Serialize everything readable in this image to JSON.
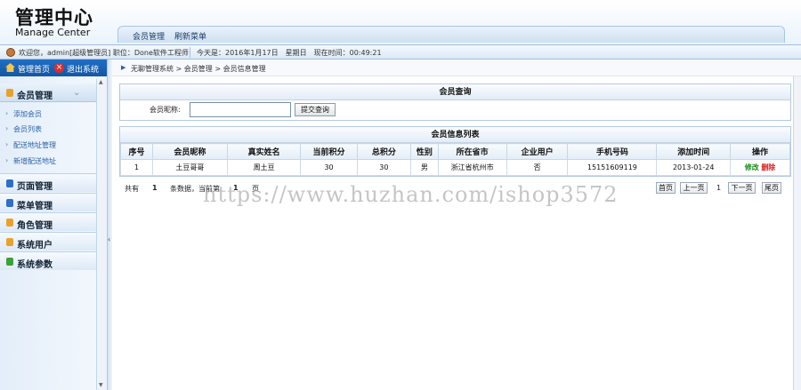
{
  "header": {
    "logo_cn": "管理中心",
    "logo_en": "Manage Center",
    "nav": [
      "会员管理",
      "刷新菜单"
    ]
  },
  "infobar": {
    "welcome": "欢迎您，admin[超级管理员] 职位：Done软件工程师",
    "today": "今天是：2016年1月17日　星期日　现在时间：00:49:21"
  },
  "sidebar": {
    "home": "管理首页",
    "exit": "退出系统",
    "groups": [
      {
        "label": "会员管理",
        "icon_color": "#e8a22b",
        "expanded": true,
        "items": [
          "添加会员",
          "会员列表",
          "配送地址管理",
          "新增配送地址"
        ]
      },
      {
        "label": "页面管理",
        "icon_color": "#2f6fc4"
      },
      {
        "label": "菜单管理",
        "icon_color": "#2f6fc4"
      },
      {
        "label": "角色管理",
        "icon_color": "#e8a22b"
      },
      {
        "label": "系统用户",
        "icon_color": "#e8a22b"
      },
      {
        "label": "系统参数",
        "icon_color": "#3aa03a"
      }
    ]
  },
  "breadcrumb": "无聊管理系统 > 会员管理 > 会员信息管理",
  "query": {
    "title": "会员查询",
    "label": "会员昵称:",
    "value": "",
    "button": "提交查询"
  },
  "list": {
    "title": "会员信息列表",
    "columns": [
      "序号",
      "会员昵称",
      "真实姓名",
      "当前积分",
      "总积分",
      "性别",
      "所在省市",
      "企业用户",
      "手机号码",
      "添加时间",
      "操作"
    ],
    "rows": [
      {
        "no": "1",
        "nick": "土豆哥哥",
        "name": "周土豆",
        "cur": "30",
        "total": "30",
        "sex": "男",
        "city": "浙江省杭州市",
        "ent": "否",
        "phone": "15151609119",
        "time": "2013-01-24",
        "edit": "修改",
        "del": "删除"
      }
    ]
  },
  "pager": {
    "total_label": "共有",
    "total": "1",
    "records_label": "条数据，当前第",
    "page": "1",
    "page_suffix": "页",
    "first": "首页",
    "prev": "上一页",
    "current": "1",
    "next": "下一页",
    "last": "尾页"
  },
  "watermark": "https://www.huzhan.com/ishop3572"
}
